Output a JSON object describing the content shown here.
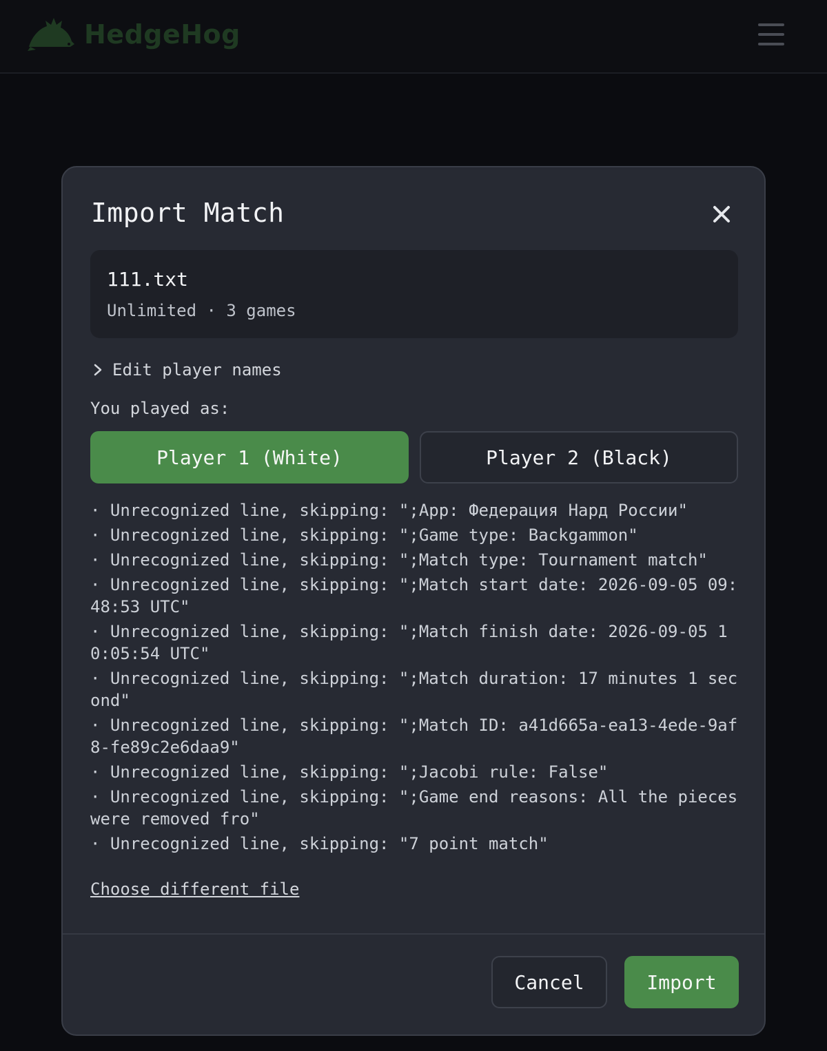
{
  "app": {
    "name": "HedgeHog"
  },
  "modal": {
    "title": "Import Match",
    "file": {
      "name": "111.txt",
      "meta": "Unlimited · 3 games"
    },
    "edit_names_label": "Edit player names",
    "played_as_label": "You played as:",
    "players": [
      {
        "label": "Player 1 (White)",
        "selected": true
      },
      {
        "label": "Player 2 (Black)",
        "selected": false
      }
    ],
    "warnings": [
      "· Unrecognized line, skipping: \";App: Федерация Нард России\"",
      "· Unrecognized line, skipping: \";Game type: Backgammon\"",
      "· Unrecognized line, skipping: \";Match type: Tournament match\"",
      "· Unrecognized line, skipping: \";Match start date: 2026-09-05 09:48:53 UTC\"",
      "· Unrecognized line, skipping: \";Match finish date: 2026-09-05 10:05:54 UTC\"",
      "· Unrecognized line, skipping: \";Match duration: 17 minutes 1 second\"",
      "· Unrecognized line, skipping: \";Match ID: a41d665a-ea13-4ede-9af8-fe89c2e6daa9\"",
      "· Unrecognized line, skipping: \";Jacobi rule: False\"",
      "· Unrecognized line, skipping: \";Game end reasons: All the pieces were removed fro\"",
      "· Unrecognized line, skipping: \"7 point match\""
    ],
    "choose_file_label": "Choose different file",
    "cancel_label": "Cancel",
    "import_label": "Import"
  },
  "colors": {
    "accent": "#4a8b4a",
    "modal_bg": "#272a33",
    "page_bg": "#0b0c10"
  }
}
